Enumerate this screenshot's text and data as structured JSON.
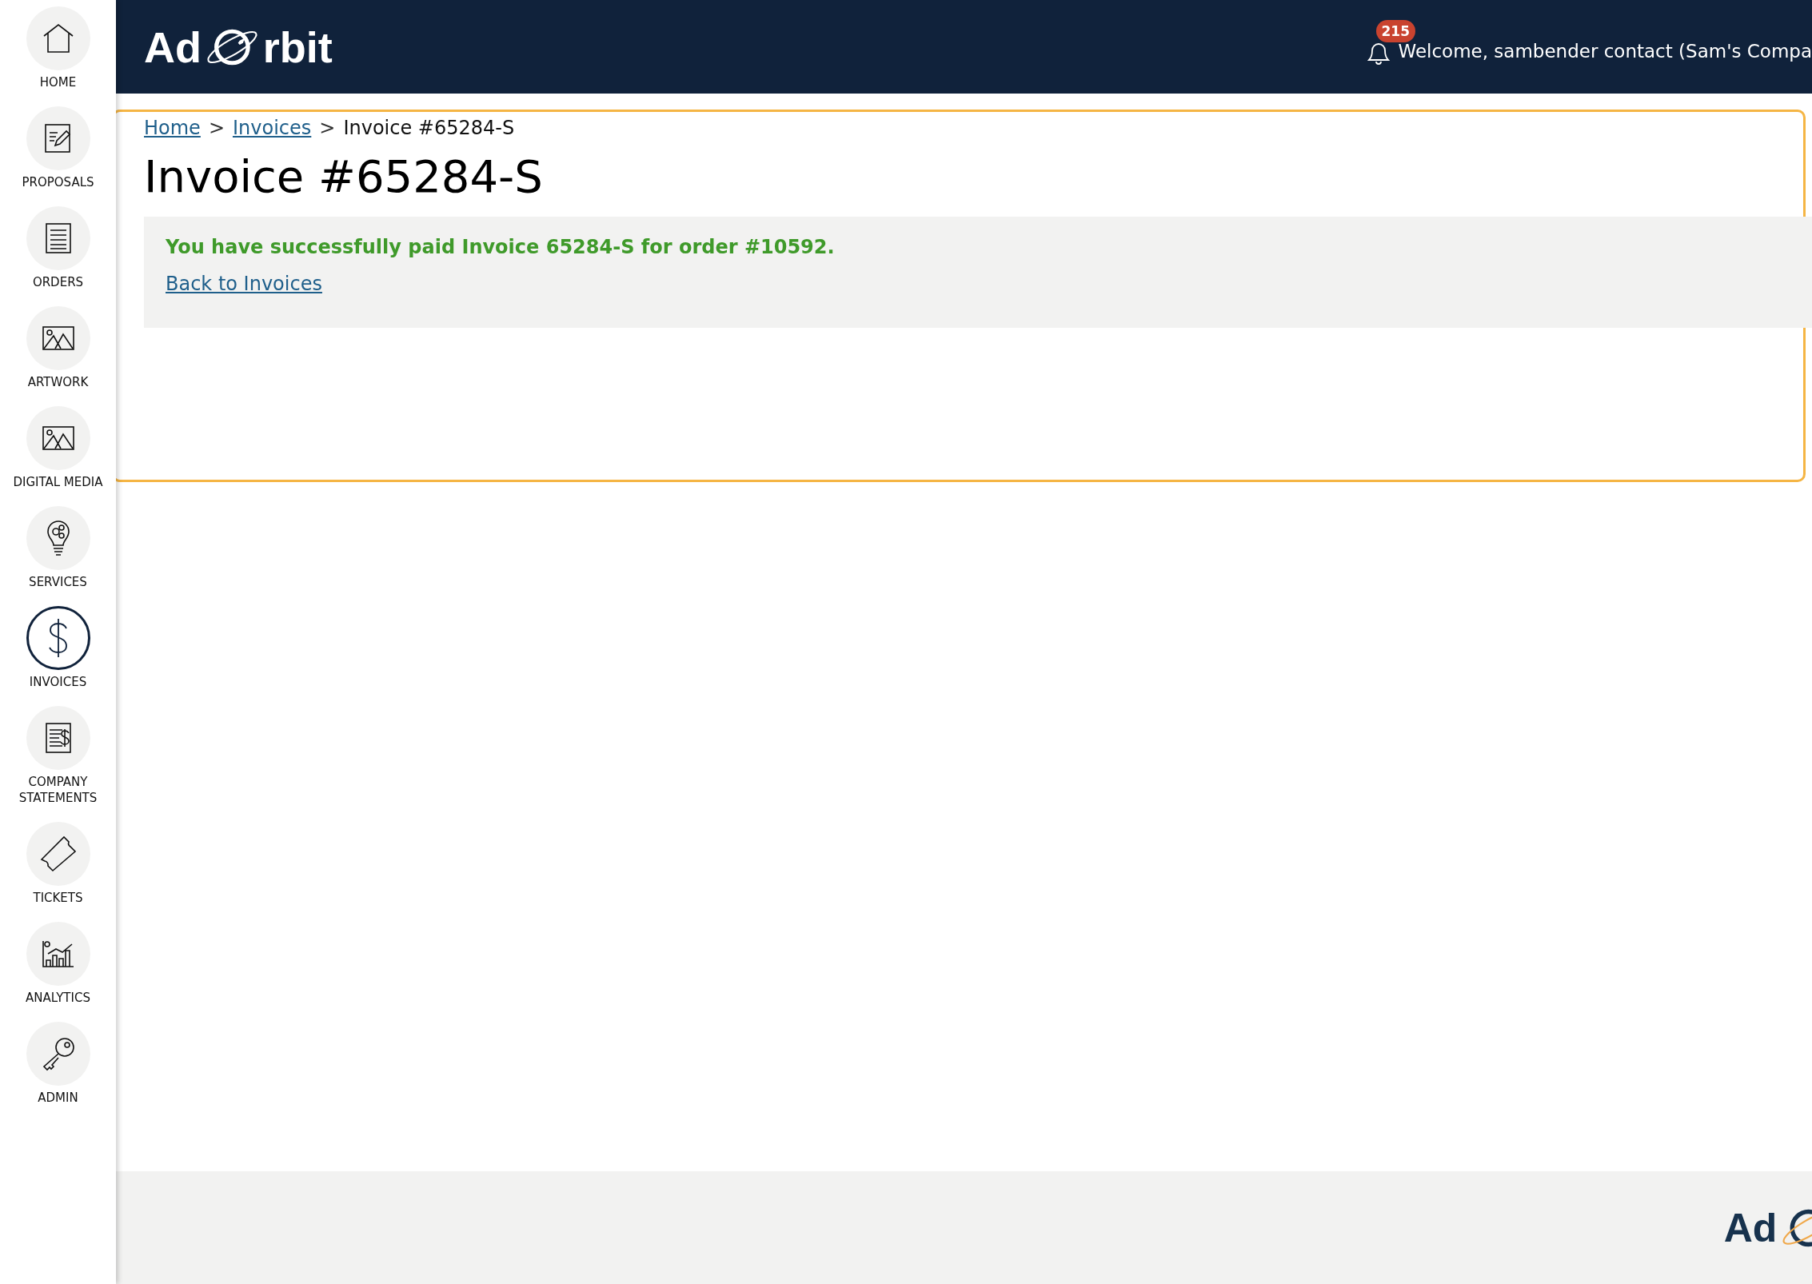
{
  "sidebar": {
    "items": [
      {
        "label": "HOME",
        "selected": false
      },
      {
        "label": "PROPOSALS",
        "selected": false
      },
      {
        "label": "ORDERS",
        "selected": false
      },
      {
        "label": "ARTWORK",
        "selected": false
      },
      {
        "label": "DIGITAL MEDIA",
        "selected": false
      },
      {
        "label": "SERVICES",
        "selected": false
      },
      {
        "label": "INVOICES",
        "selected": true
      },
      {
        "label": "COMPANY STATEMENTS",
        "selected": false
      },
      {
        "label": "TICKETS",
        "selected": false
      },
      {
        "label": "ANALYTICS",
        "selected": false
      },
      {
        "label": "ADMIN",
        "selected": false
      }
    ]
  },
  "header": {
    "logo": {
      "before": "Ad",
      "after": "rbit"
    },
    "notifications": "215",
    "welcome": "Welcome, sambender contact (Sam's Compa"
  },
  "breadcrumb": {
    "links": [
      "Home",
      "Invoices"
    ],
    "current": "Invoice #65284-S",
    "separator": ">"
  },
  "title": "Invoice #65284-S",
  "notice": {
    "message": "You have successfully paid Invoice 65284-S for order #10592.",
    "link": "Back to Invoices"
  },
  "footer": {
    "logo": {
      "before": "Ad"
    }
  }
}
